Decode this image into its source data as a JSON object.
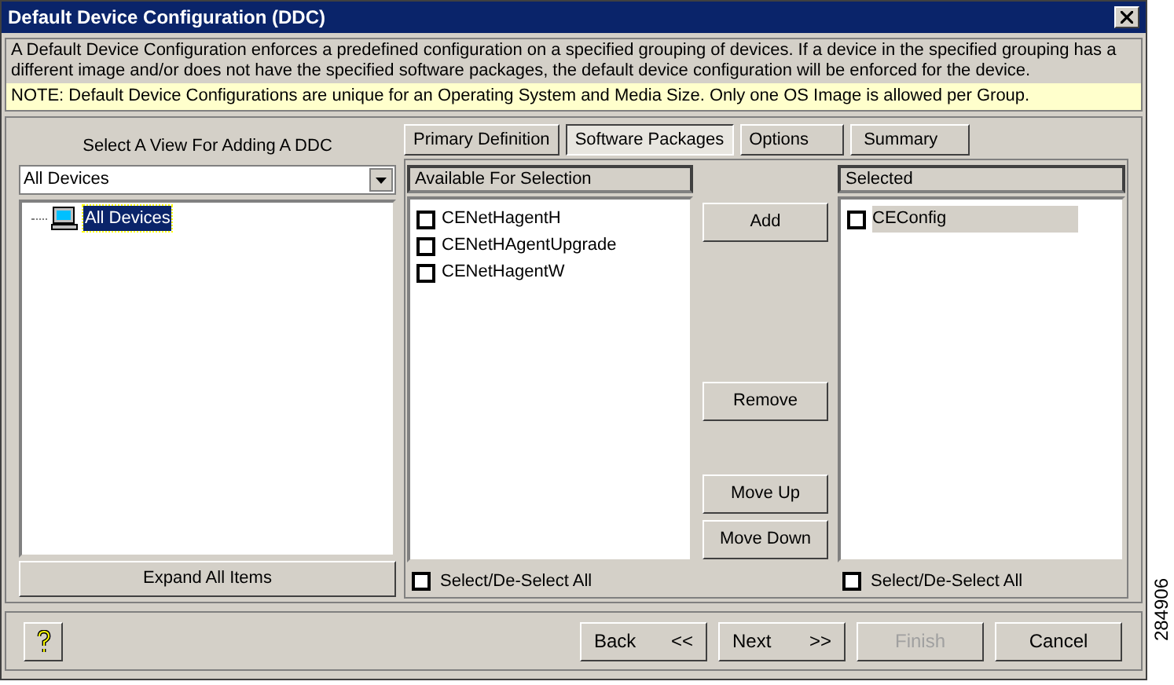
{
  "window": {
    "title": "Default Device Configuration (DDC)"
  },
  "description": "A Default Device Configuration enforces a predefined configuration on a specified grouping of devices.  If a device in the specified grouping has a different image and/or does not have the specified software packages, the default device configuration will be enforced for the device.",
  "note": "NOTE: Default Device Configurations are unique for an Operating System and Media Size.  Only one OS Image is allowed per Group.",
  "view_panel": {
    "label": "Select A View For Adding A DDC",
    "dropdown": {
      "value": "All Devices"
    },
    "tree": [
      {
        "label": "All Devices",
        "selected": true
      }
    ],
    "expand_button": "Expand All Items"
  },
  "tabs": [
    {
      "label": "Primary Definition",
      "selected": false
    },
    {
      "label": "Software Packages",
      "selected": true
    },
    {
      "label": "Options",
      "selected": false
    },
    {
      "label": "Summary",
      "selected": false
    }
  ],
  "available": {
    "header": "Available For Selection",
    "items": [
      {
        "label": "CENetHagentH",
        "checked": false,
        "selected": false
      },
      {
        "label": "CENetHAgentUpgrade",
        "checked": false,
        "selected": false
      },
      {
        "label": "CENetHagentW",
        "checked": false,
        "selected": false
      }
    ],
    "select_all": {
      "label": "Select/De-Select All",
      "checked": false
    }
  },
  "actions": [
    "Add",
    "Remove",
    "Move Up",
    "Move Down"
  ],
  "selected_list": {
    "header": "Selected",
    "items": [
      {
        "label": "CEConfig",
        "checked": false,
        "selected": true
      }
    ],
    "select_all": {
      "label": "Select/De-Select All",
      "checked": false
    }
  },
  "footer": {
    "buttons": [
      {
        "label": "Back",
        "arrows": "<<",
        "disabled": false
      },
      {
        "label": "Next",
        "arrows": ">>",
        "disabled": false
      },
      {
        "label": "Finish",
        "disabled": true
      },
      {
        "label": "Cancel",
        "disabled": false
      }
    ]
  },
  "figure_id": "284906"
}
